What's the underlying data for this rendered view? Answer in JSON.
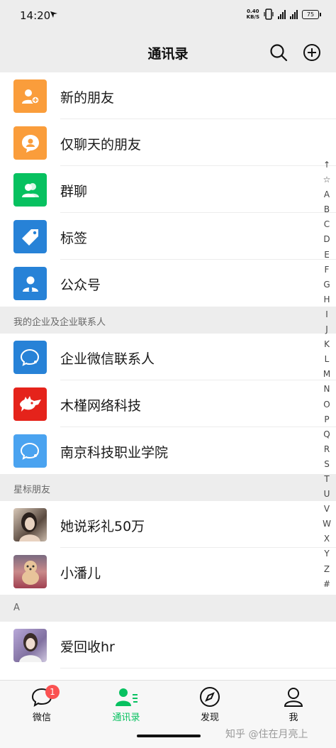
{
  "status_bar": {
    "time": "14:20",
    "net_speed_value": "0.40",
    "net_speed_unit": "KB/S",
    "battery": "75"
  },
  "header": {
    "title": "通讯录"
  },
  "functions": [
    {
      "label": "新的朋友",
      "icon": "add-friend-icon",
      "color": "#fa9d3b"
    },
    {
      "label": "仅聊天的朋友",
      "icon": "chat-only-icon",
      "color": "#fa9d3b"
    },
    {
      "label": "群聊",
      "icon": "group-icon",
      "color": "#07c160"
    },
    {
      "label": "标签",
      "icon": "tag-icon",
      "color": "#2782d7"
    },
    {
      "label": "公众号",
      "icon": "official-account-icon",
      "color": "#2782d7"
    }
  ],
  "enterprise": {
    "header": "我的企业及企业联系人",
    "items": [
      {
        "label": "企业微信联系人",
        "icon": "wecom-icon",
        "color": "#2782d7"
      },
      {
        "label": "木槿网络科技",
        "icon": "jd-dog-logo",
        "color": "#e5231b"
      },
      {
        "label": "南京科技职业学院",
        "icon": "wecom-icon",
        "color": "#4aa3f0"
      }
    ]
  },
  "starred": {
    "header": "星标朋友",
    "items": [
      {
        "label": "她说彩礼50万",
        "icon": "avatar-photo"
      },
      {
        "label": "小潘儿",
        "icon": "avatar-dog-photo"
      }
    ]
  },
  "section_a": {
    "header": "A",
    "items": [
      {
        "label": "爱回收hr",
        "icon": "avatar-photo"
      }
    ]
  },
  "alpha_index": [
    "↑",
    "☆",
    "A",
    "B",
    "C",
    "D",
    "E",
    "F",
    "G",
    "H",
    "I",
    "J",
    "K",
    "L",
    "M",
    "N",
    "O",
    "P",
    "Q",
    "R",
    "S",
    "T",
    "U",
    "V",
    "W",
    "X",
    "Y",
    "Z",
    "#"
  ],
  "tabbar": {
    "tabs": [
      {
        "label": "微信",
        "badge": "1"
      },
      {
        "label": "通讯录"
      },
      {
        "label": "发现"
      },
      {
        "label": "我"
      }
    ],
    "active_color": "#07c160"
  },
  "watermark": "知乎 @住在月亮上"
}
